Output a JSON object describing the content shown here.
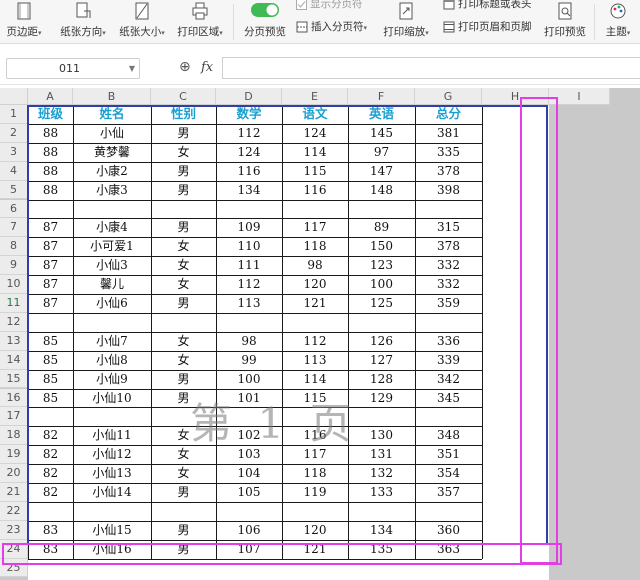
{
  "ribbon": {
    "margins": "页边距",
    "orientation": "纸张方向",
    "size": "纸张大小",
    "print_area": "打印区域",
    "page_break_preview": "分页预览",
    "show_page_breaks": "显示分页符",
    "insert_page_break": "插入分页符",
    "print_scaling": "打印缩放",
    "print_titles": "打印标题或表头",
    "print_header_footer": "打印页眉和页脚",
    "print_preview": "打印预览",
    "theme": "主题",
    "caret": "▾"
  },
  "formula_bar": {
    "name_box": "011",
    "zoom_icon": "⊕",
    "fx_label": "fx",
    "formula": ""
  },
  "columns": [
    "A",
    "B",
    "C",
    "D",
    "E",
    "F",
    "G",
    "H",
    "I"
  ],
  "row_numbers": [
    "1",
    "2",
    "3",
    "4",
    "5",
    "6",
    "7",
    "8",
    "9",
    "10",
    "11",
    "12",
    "13",
    "14",
    "15",
    "16",
    "17",
    "18",
    "19",
    "20",
    "21",
    "22",
    "23",
    "24",
    "25"
  ],
  "selected_row": "11",
  "table": {
    "headers": [
      "班级",
      "姓名",
      "性别",
      "数学",
      "语文",
      "英语",
      "总分"
    ],
    "rows": [
      [
        "88",
        "小仙",
        "男",
        "112",
        "124",
        "145",
        "381"
      ],
      [
        "88",
        "黄梦馨",
        "女",
        "124",
        "114",
        "97",
        "335"
      ],
      [
        "88",
        "小康2",
        "男",
        "116",
        "115",
        "147",
        "378"
      ],
      [
        "88",
        "小康3",
        "男",
        "134",
        "116",
        "148",
        "398"
      ],
      [
        "",
        "",
        "",
        "",
        "",
        "",
        ""
      ],
      [
        "87",
        "小康4",
        "男",
        "109",
        "117",
        "89",
        "315"
      ],
      [
        "87",
        "小可爱1",
        "女",
        "110",
        "118",
        "150",
        "378"
      ],
      [
        "87",
        "小仙3",
        "女",
        "111",
        "98",
        "123",
        "332"
      ],
      [
        "87",
        "馨儿",
        "女",
        "112",
        "120",
        "100",
        "332"
      ],
      [
        "87",
        "小仙6",
        "男",
        "113",
        "121",
        "125",
        "359"
      ],
      [
        "",
        "",
        "",
        "",
        "",
        "",
        ""
      ],
      [
        "85",
        "小仙7",
        "女",
        "98",
        "112",
        "126",
        "336"
      ],
      [
        "85",
        "小仙8",
        "女",
        "99",
        "113",
        "127",
        "339"
      ],
      [
        "85",
        "小仙9",
        "男",
        "100",
        "114",
        "128",
        "342"
      ],
      [
        "85",
        "小仙10",
        "男",
        "101",
        "115",
        "129",
        "345"
      ],
      [
        "",
        "",
        "",
        "",
        "",
        "",
        ""
      ],
      [
        "82",
        "小仙11",
        "女",
        "102",
        "116",
        "130",
        "348"
      ],
      [
        "82",
        "小仙12",
        "女",
        "103",
        "117",
        "131",
        "351"
      ],
      [
        "82",
        "小仙13",
        "女",
        "104",
        "118",
        "132",
        "354"
      ],
      [
        "82",
        "小仙14",
        "男",
        "105",
        "119",
        "133",
        "357"
      ],
      [
        "",
        "",
        "",
        "",
        "",
        "",
        ""
      ],
      [
        "83",
        "小仙15",
        "男",
        "106",
        "120",
        "134",
        "360"
      ],
      [
        "83",
        "小仙16",
        "男",
        "107",
        "121",
        "135",
        "363"
      ]
    ]
  },
  "watermark": "第 1 页",
  "colors": {
    "header_text": "#1a9fd0",
    "page_border": "#2f3fa7",
    "break_line": "#e23de6",
    "toggle_on": "#3fba55"
  }
}
